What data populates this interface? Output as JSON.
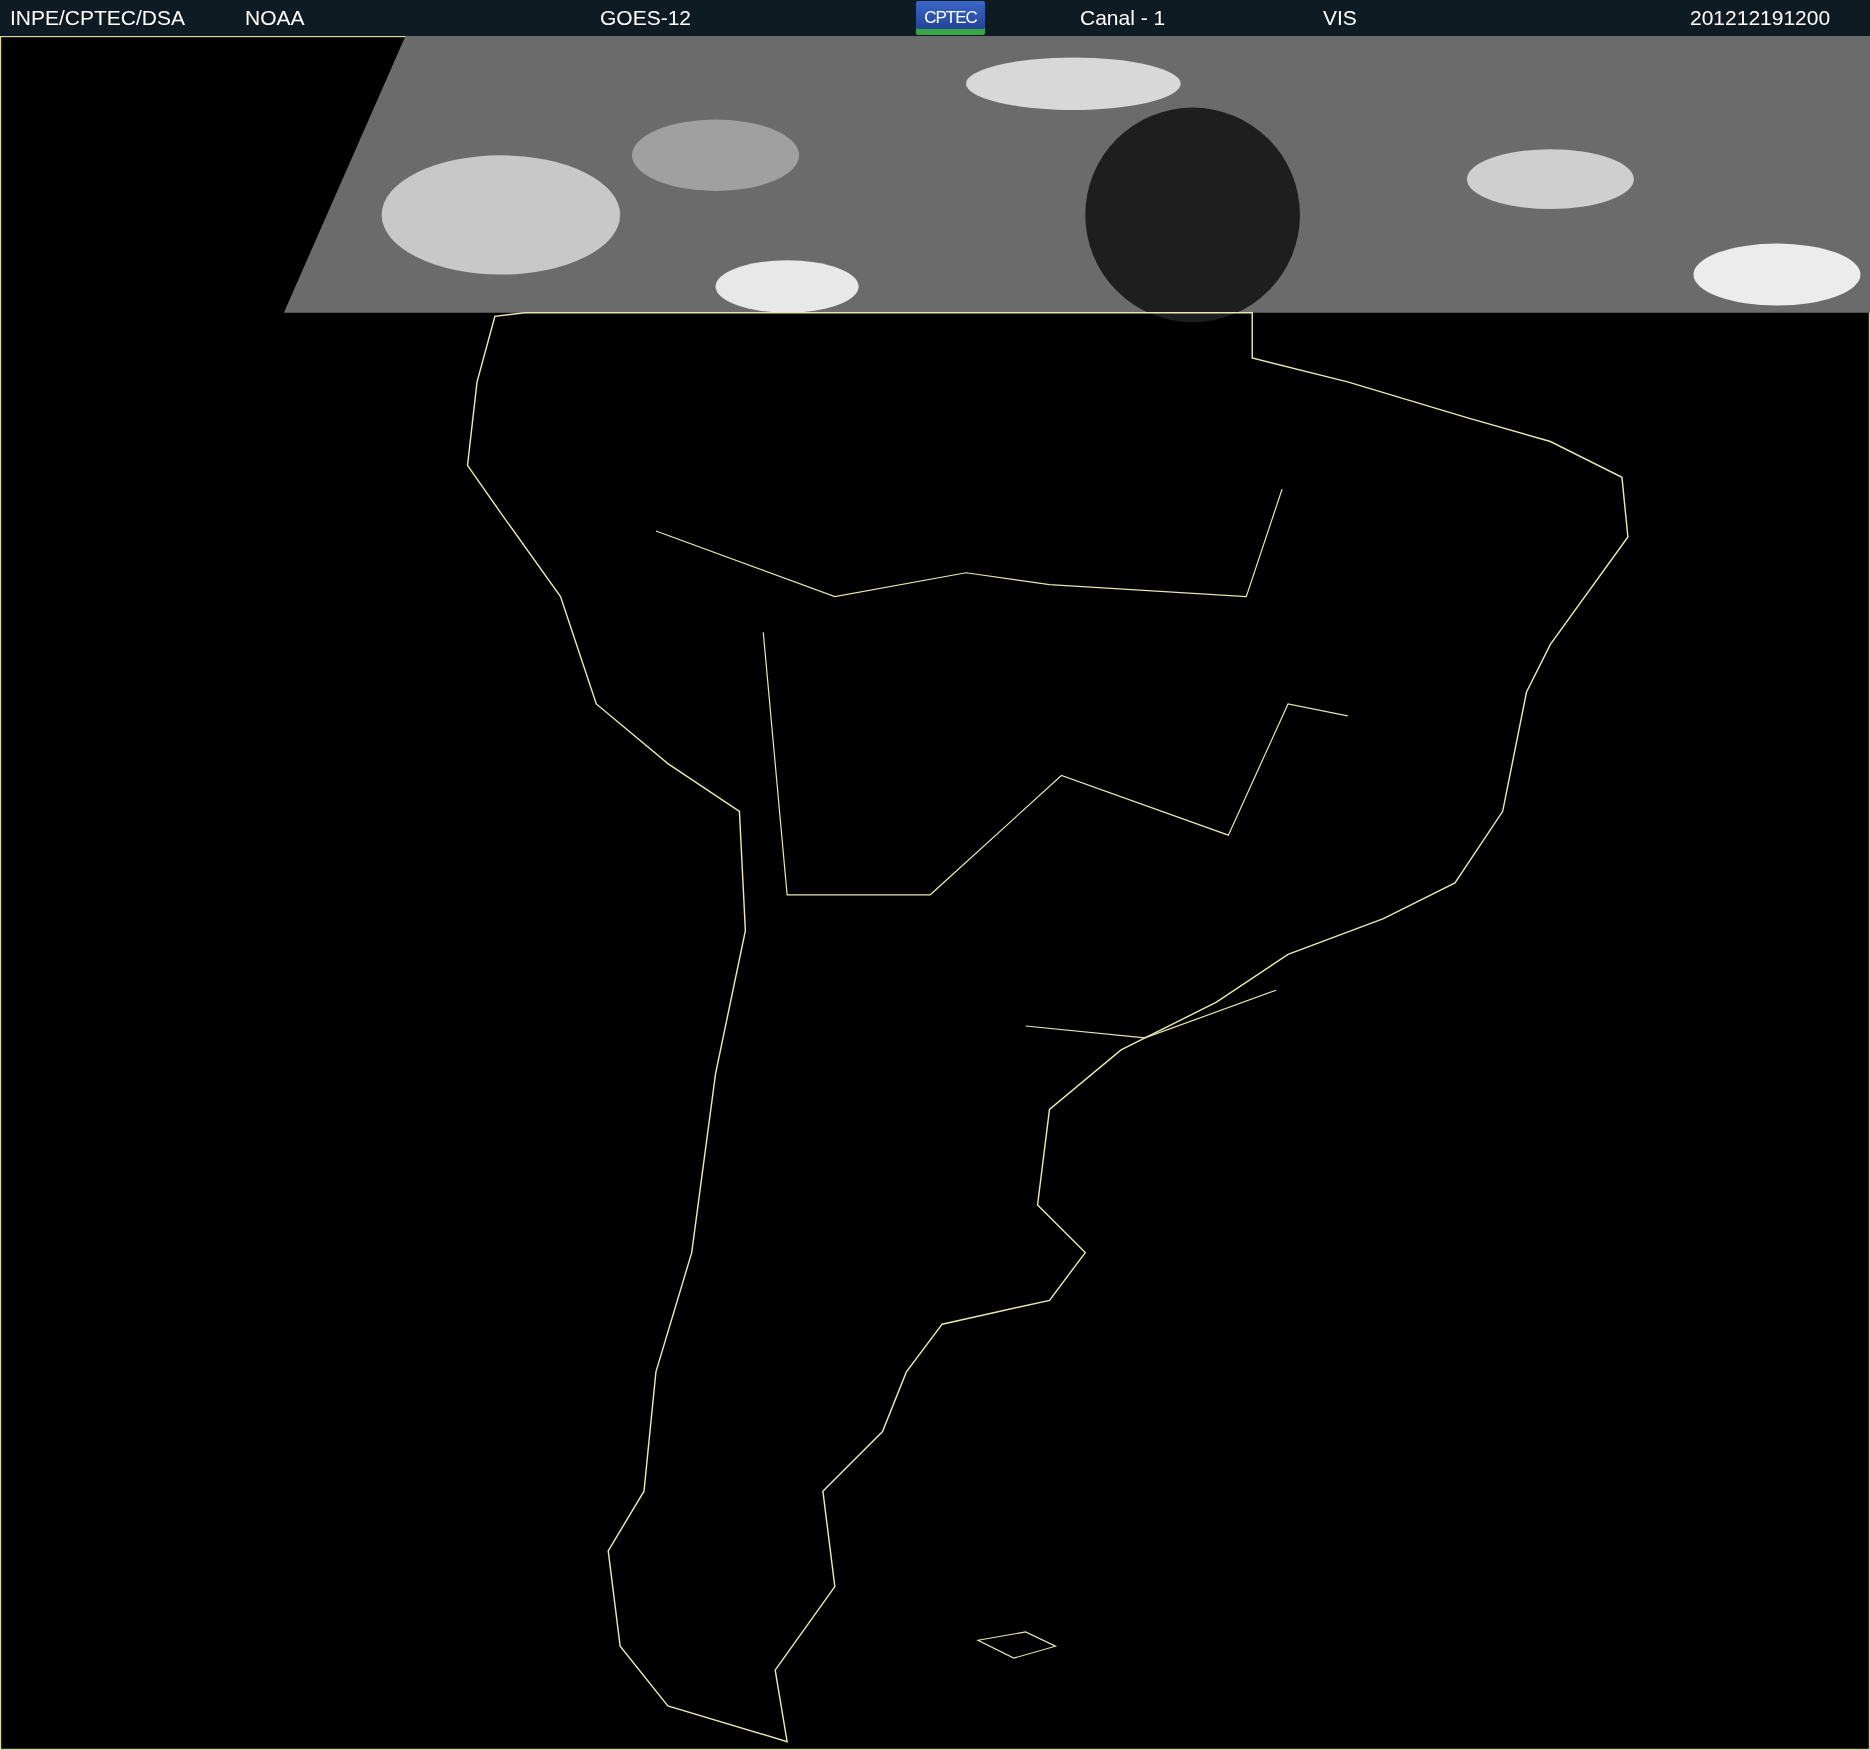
{
  "header": {
    "source": "INPE/CPTEC/DSA",
    "agency": "NOAA",
    "satellite": "GOES-12",
    "logo": "CPTEC",
    "channel": "Canal - 1",
    "band": "VIS",
    "timestamp": "201212191200"
  }
}
